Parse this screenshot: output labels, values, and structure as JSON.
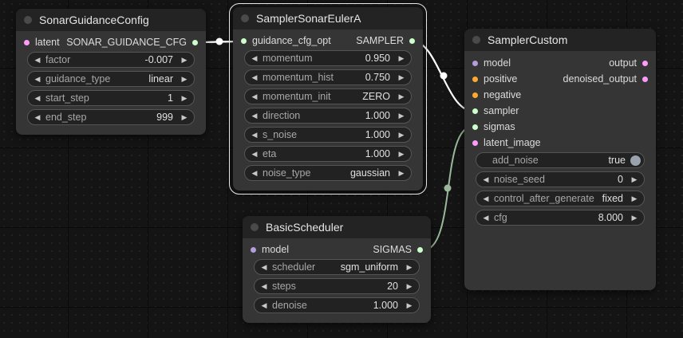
{
  "colors": {
    "latent": "#ff9cf9",
    "model": "#b39ddb",
    "conditioning": "#ffa931",
    "sampler": "#ecb4b4",
    "sigmas": "#cdffcd",
    "image": "#64b5f6",
    "link_active": "#ffffff",
    "link_sigmas": "#9ab89a"
  },
  "nodes": {
    "sonar_config": {
      "title": "SonarGuidanceConfig",
      "input_label": "latent",
      "output_label": "SONAR_GUIDANCE_CFG",
      "widgets": [
        {
          "label": "factor",
          "value": "-0.007"
        },
        {
          "label": "guidance_type",
          "value": "linear"
        },
        {
          "label": "start_step",
          "value": "1"
        },
        {
          "label": "end_step",
          "value": "999"
        }
      ]
    },
    "sampler_euler": {
      "title": "SamplerSonarEulerA",
      "input_label": "guidance_cfg_opt",
      "output_label": "SAMPLER",
      "widgets": [
        {
          "label": "momentum",
          "value": "0.950"
        },
        {
          "label": "momentum_hist",
          "value": "0.750"
        },
        {
          "label": "momentum_init",
          "value": "ZERO"
        },
        {
          "label": "direction",
          "value": "1.000"
        },
        {
          "label": "s_noise",
          "value": "1.000"
        },
        {
          "label": "eta",
          "value": "1.000"
        },
        {
          "label": "noise_type",
          "value": "gaussian"
        }
      ]
    },
    "basic_scheduler": {
      "title": "BasicScheduler",
      "input_label": "model",
      "output_label": "SIGMAS",
      "widgets": [
        {
          "label": "scheduler",
          "value": "sgm_uniform"
        },
        {
          "label": "steps",
          "value": "20"
        },
        {
          "label": "denoise",
          "value": "1.000"
        }
      ]
    },
    "sampler_custom": {
      "title": "SamplerCustom",
      "inputs": [
        "model",
        "positive",
        "negative",
        "sampler",
        "sigmas",
        "latent_image"
      ],
      "outputs": [
        "output",
        "denoised_output"
      ],
      "toggle": {
        "label": "add_noise",
        "value": "true"
      },
      "widgets": [
        {
          "label": "noise_seed",
          "value": "0"
        },
        {
          "label": "control_after_generate",
          "value": "fixed"
        },
        {
          "label": "cfg",
          "value": "8.000"
        }
      ]
    }
  }
}
